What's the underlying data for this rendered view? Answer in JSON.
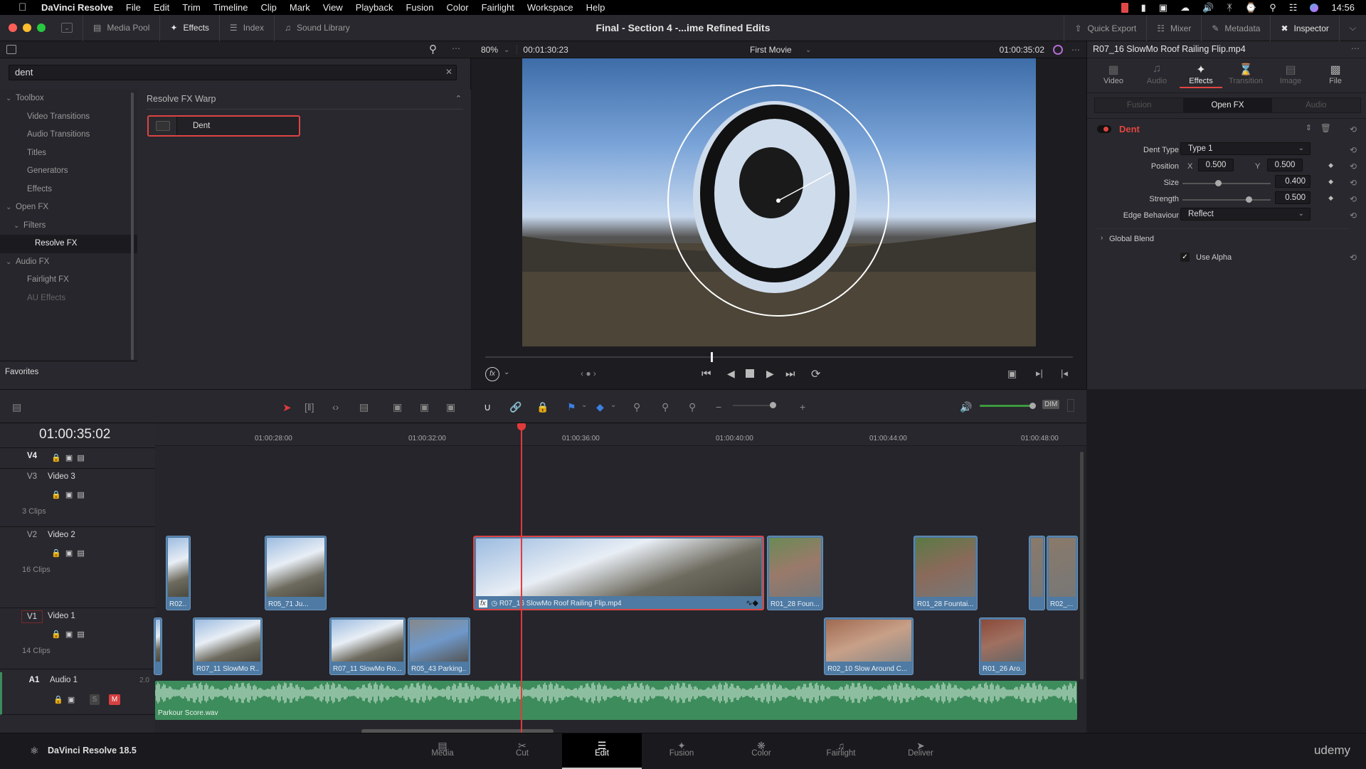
{
  "menubar": {
    "app_name": "DaVinci Resolve",
    "items": [
      "File",
      "Edit",
      "Trim",
      "Timeline",
      "Clip",
      "Mark",
      "View",
      "Playback",
      "Fusion",
      "Color",
      "Fairlight",
      "Workspace",
      "Help"
    ],
    "clock": "14:56"
  },
  "toolbar": {
    "media_pool": "Media Pool",
    "effects": "Effects",
    "index": "Index",
    "sound_library": "Sound Library",
    "window_title": "Final - Section 4 -...ime  Refined Edits",
    "quick_export": "Quick Export",
    "mixer": "Mixer",
    "metadata": "Metadata",
    "inspector": "Inspector"
  },
  "viewer": {
    "zoom": "80%",
    "source_timecode": "00:01:30:23",
    "timeline_name": "First Movie",
    "record_timecode": "01:00:35:02"
  },
  "effects_panel": {
    "search_value": "dent",
    "tree": [
      {
        "label": "Toolbox",
        "level": 0,
        "expanded": true
      },
      {
        "label": "Video Transitions",
        "level": 1
      },
      {
        "label": "Audio Transitions",
        "level": 1
      },
      {
        "label": "Titles",
        "level": 1
      },
      {
        "label": "Generators",
        "level": 1
      },
      {
        "label": "Effects",
        "level": 1
      },
      {
        "label": "Open FX",
        "level": 0,
        "expanded": true
      },
      {
        "label": "Filters",
        "level": 1,
        "expanded": true
      },
      {
        "label": "Resolve FX",
        "level": 2,
        "selected": true
      },
      {
        "label": "Audio FX",
        "level": 0,
        "expanded": true
      },
      {
        "label": "Fairlight FX",
        "level": 1
      },
      {
        "label": "AU Effects",
        "level": 1
      }
    ],
    "favorites": "Favorites",
    "group_title": "Resolve FX Warp",
    "result_item": "Dent"
  },
  "inspector": {
    "clip_name": "R07_16 SlowMo Roof Railing Flip.mp4",
    "tabs": [
      {
        "label": "Video",
        "active": false,
        "enabled": true
      },
      {
        "label": "Audio",
        "active": false,
        "enabled": false
      },
      {
        "label": "Effects",
        "active": true,
        "enabled": true
      },
      {
        "label": "Transition",
        "active": false,
        "enabled": false
      },
      {
        "label": "Image",
        "active": false,
        "enabled": false
      },
      {
        "label": "File",
        "active": false,
        "enabled": true
      }
    ],
    "subtabs": [
      "Fusion",
      "Open FX",
      "Audio"
    ],
    "active_subtab": "Open FX",
    "effect_name": "Dent",
    "params": {
      "dent_type_label": "Dent Type",
      "dent_type_value": "Type 1",
      "position_label": "Position",
      "x_label": "X",
      "x_value": "0.500",
      "y_label": "Y",
      "y_value": "0.500",
      "size_label": "Size",
      "size_value": "0.400",
      "size_fraction": 0.4,
      "strength_label": "Strength",
      "strength_value": "0.500",
      "strength_fraction": 0.75,
      "edge_label": "Edge Behaviour",
      "edge_value": "Reflect",
      "global_blend": "Global Blend",
      "use_alpha": "Use Alpha",
      "use_alpha_checked": true
    },
    "accent_color": "#e0453f"
  },
  "timeline": {
    "timecode": "01:00:35:02",
    "ruler_ticks": [
      "01:00:28:00",
      "01:00:32:00",
      "01:00:36:00",
      "01:00:40:00",
      "01:00:44:00",
      "01:00:48:00"
    ],
    "tracks": [
      {
        "id": "V4",
        "name": "",
        "clips": ""
      },
      {
        "id": "V3",
        "name": "Video 3",
        "clips": "3 Clips"
      },
      {
        "id": "V2",
        "name": "Video 2",
        "clips": "16 Clips"
      },
      {
        "id": "V1",
        "name": "Video 1",
        "clips": "14 Clips"
      },
      {
        "id": "A1",
        "name": "Audio 1",
        "clips": "",
        "channels": "2.0"
      }
    ],
    "v2_clips": [
      "R02...",
      "R05_71 Ju...",
      "R07_16 SlowMo Roof Railing Flip.mp4",
      "R01_28 Foun...",
      "R01_28 Fountai...",
      "R02_..."
    ],
    "v1_clips": [
      "R07_11 SlowMo R...",
      "R07_11 SlowMo Ro...",
      "R05_43 Parking...",
      "R02_10 Slow Around C...",
      "R01_26 Aro..."
    ],
    "audio_clip": "Parkour Score.wav",
    "solo": "S",
    "mute": "M",
    "dim": "DIM",
    "volume_fraction": 1.0
  },
  "pagebar": {
    "brand": "DaVinci Resolve 18.5",
    "pages": [
      "Media",
      "Cut",
      "Edit",
      "Fusion",
      "Color",
      "Fairlight",
      "Deliver"
    ],
    "active": "Edit",
    "watermark": "udemy"
  }
}
